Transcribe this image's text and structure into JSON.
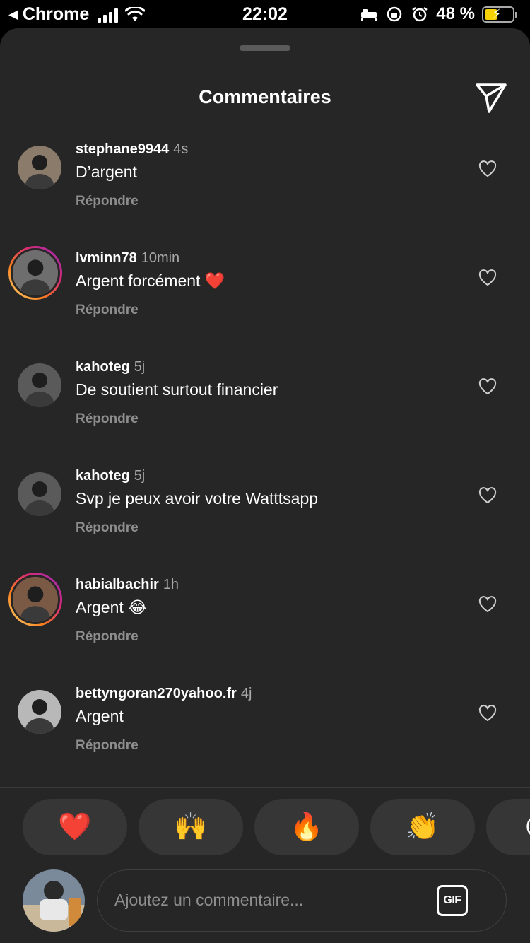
{
  "status_bar": {
    "back_app": "Chrome",
    "time": "22:02",
    "battery": "48 %",
    "battery_level": 0.48
  },
  "sheet": {
    "title": "Commentaires"
  },
  "comments": [
    {
      "user": "stephane9944",
      "time": "4s",
      "text": "D’argent",
      "reply": "Répondre",
      "ring": false,
      "avatar_color": "#8a7b6a"
    },
    {
      "user": "lvminn78",
      "time": "10min",
      "text": "Argent forcément ❤️",
      "reply": "Répondre",
      "ring": true,
      "avatar_color": "#6e6e6e"
    },
    {
      "user": "kahoteg",
      "time": "5j",
      "text": "De soutient surtout financier",
      "reply": "Répondre",
      "ring": false,
      "avatar_color": "#5a5a5a"
    },
    {
      "user": "kahoteg",
      "time": "5j",
      "text": "Svp je peux avoir votre Watttsapp",
      "reply": "Répondre",
      "ring": false,
      "avatar_color": "#5a5a5a"
    },
    {
      "user": "habialbachir",
      "time": "1h",
      "text": "Argent 😂",
      "reply": "Répondre",
      "ring": true,
      "avatar_color": "#7a5a44"
    },
    {
      "user": "bettyngoran270yahoo.fr",
      "time": "4j",
      "text": "Argent",
      "reply": "Répondre",
      "ring": false,
      "avatar_color": "#b8b8b8"
    }
  ],
  "reactions": [
    "❤️",
    "🙌",
    "🔥",
    "👏",
    "😢"
  ],
  "composer": {
    "placeholder": "Ajoutez un commentaire...",
    "gif_label": "GIF"
  },
  "colors": {
    "background": "#262626",
    "accent_ring": "#d62976",
    "muted_text": "#8e8e8e"
  }
}
